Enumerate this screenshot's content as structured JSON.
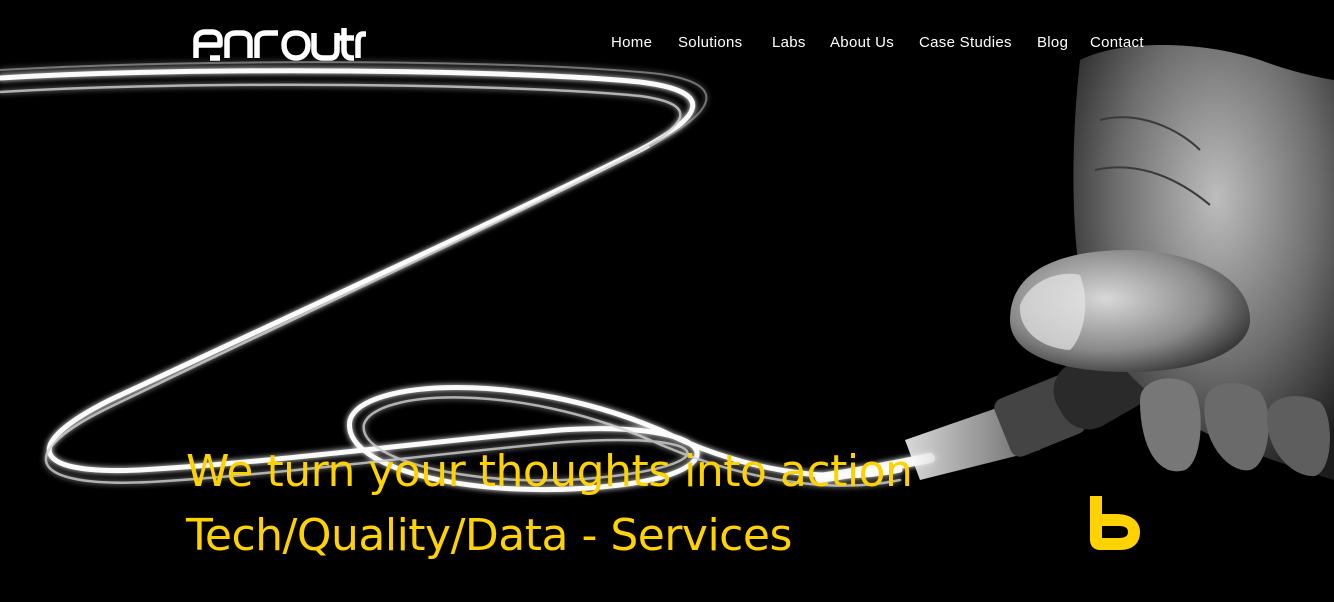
{
  "brand": {
    "name": "enroute",
    "accent_color": "#ffd200",
    "badge_icon": "enroute-monogram-icon"
  },
  "nav": {
    "items": [
      {
        "label": "Home"
      },
      {
        "label": "Solutions"
      },
      {
        "label": "Labs"
      },
      {
        "label": "About Us"
      },
      {
        "label": "Case Studies"
      },
      {
        "label": "Blog"
      },
      {
        "label": "Contact"
      }
    ]
  },
  "hero": {
    "line1": "We turn your thoughts into action",
    "line2": "Tech/Quality/Data - Services",
    "background": "light-painting-brush-photo"
  }
}
